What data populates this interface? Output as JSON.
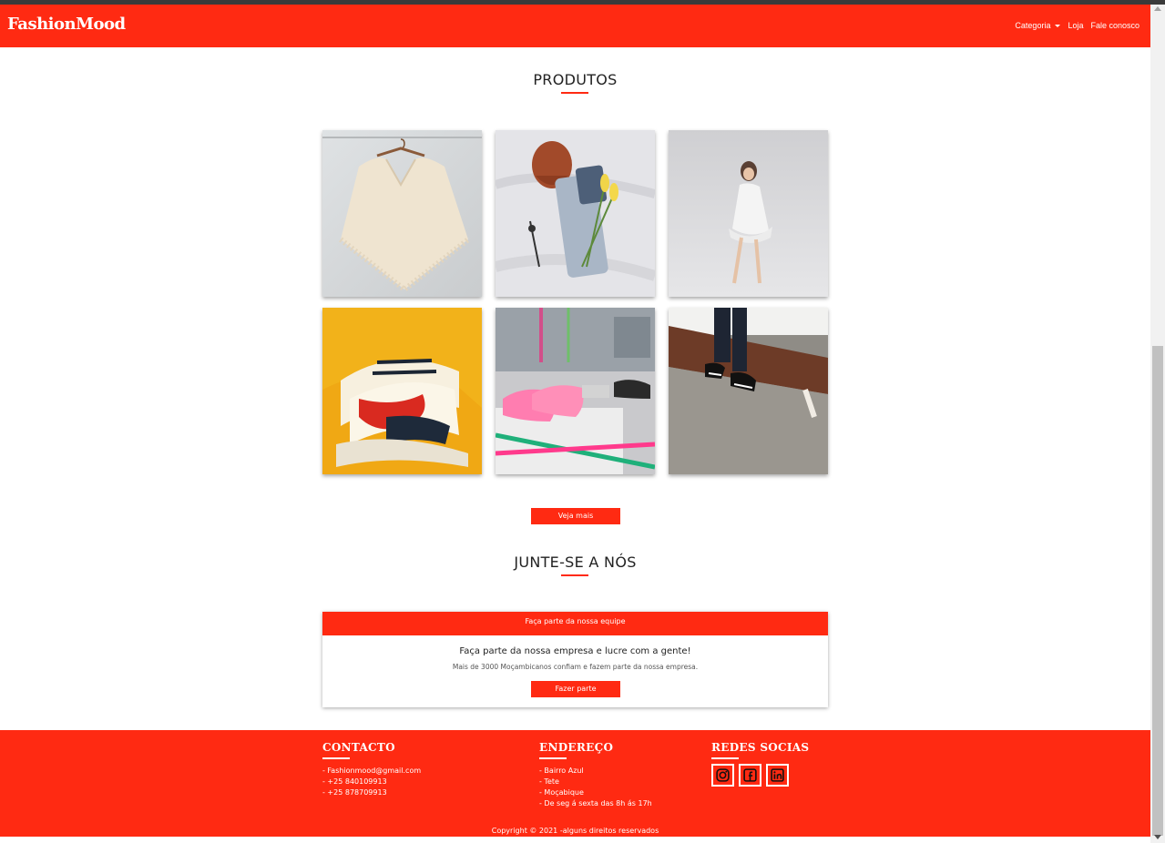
{
  "navbar": {
    "brand": "FashionMood",
    "links": [
      {
        "label": "Categoria",
        "dropdown": true
      },
      {
        "label": "Loja"
      },
      {
        "label": "Fale conosco"
      }
    ]
  },
  "products": {
    "title": "PRODUTOS",
    "items": [
      {
        "image": "knit-poncho-on-hanger"
      },
      {
        "image": "flatlay-jeans-beanie-flowers"
      },
      {
        "image": "girl-in-white-dress"
      },
      {
        "image": "yellow-sneakers-closeup"
      },
      {
        "image": "pink-sneakers-workshop"
      },
      {
        "image": "legs-black-sneakers-skatepark"
      }
    ],
    "more_button": "Veja mais"
  },
  "join": {
    "title": "JUNTE-SE A NÓS",
    "card_header": "Faça parte da nossa equipe",
    "heading": "Faça parte da nossa empresa e lucre com a gente!",
    "text": "Mais de 3000 Moçambicanos confiam e fazem parte da nossa empresa.",
    "button": "Fazer parte"
  },
  "footer": {
    "contact": {
      "heading": "CONTACTO",
      "lines": [
        "- Fashionmood@gmail.com",
        "- +25 840109913",
        "- +25 878709913"
      ]
    },
    "address": {
      "heading": "ENDEREÇO",
      "lines": [
        "- Bairro Azul",
        "- Tete",
        "- Moçabique",
        "- De seg á sexta das 8h ás 17h"
      ]
    },
    "social": {
      "heading": "REDES SOCIAS",
      "icons": [
        "instagram-icon",
        "facebook-icon",
        "linkedin-icon"
      ]
    },
    "copyright": "Copyright © 2021 -alguns direitos reservados"
  },
  "colors": {
    "brand_red": "#ff2a12"
  }
}
